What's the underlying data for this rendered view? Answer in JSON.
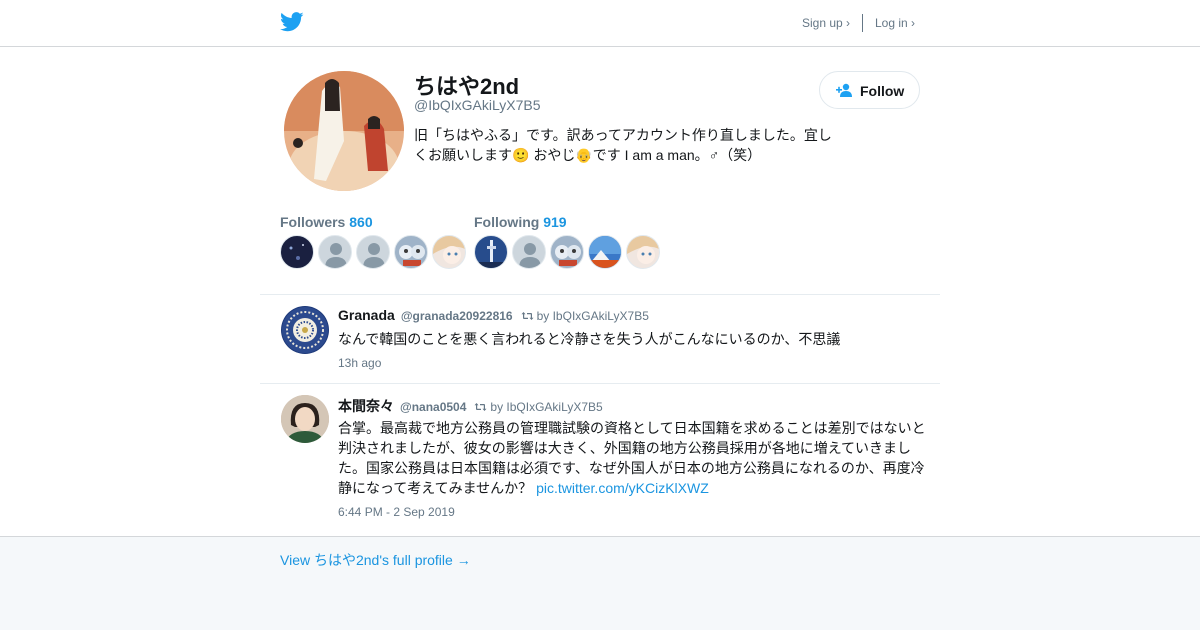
{
  "header": {
    "logo_icon": "twitter-bird-icon",
    "signup_label": "Sign up ›",
    "login_label": "Log in ›"
  },
  "colors": {
    "accent": "#1b95e0",
    "bird": "#1da1f2",
    "muted": "#657786",
    "text": "#14171a"
  },
  "profile": {
    "name": "ちはや2nd",
    "handle": "@IbQIxGAkiLyX7B5",
    "bio": "旧「ちはやふる」です。訳あってアカウント作り直しました。宜しくお願いします🙂 おやじ👴です I am a man。♂（笑）",
    "follow_label": "Follow",
    "follow_icon": "add-person-icon"
  },
  "stats": {
    "followers_label": "Followers",
    "followers_count": "860",
    "following_label": "Following",
    "following_count": "919"
  },
  "tweets": [
    {
      "name": "Granada",
      "handle": "@granada20922816",
      "retweet_by": "by IbQIxGAkiLyX7B5",
      "text": "なんで韓国のことを悪く言われると冷静さを失う人がこんなにいるのか、不思議",
      "link": "",
      "time": "13h ago"
    },
    {
      "name": "本間奈々",
      "handle": "@nana0504",
      "retweet_by": "by IbQIxGAkiLyX7B5",
      "text": "合掌。最高裁で地方公務員の管理職試験の資格として日本国籍を求めることは差別ではないと判決されましたが、彼女の影響は大きく、外国籍の地方公務員採用が各地に増えていきました。国家公務員は日本国籍は必須です、なぜ外国人が日本の地方公務員になれるのか、再度冷静になって考えてみませんか？",
      "link": "pic.twitter.com/yKCizKlXWZ",
      "time": "6:44 PM - 2 Sep 2019"
    }
  ],
  "footer": {
    "view_profile_label": "View ちはや2nd's full profile →"
  }
}
